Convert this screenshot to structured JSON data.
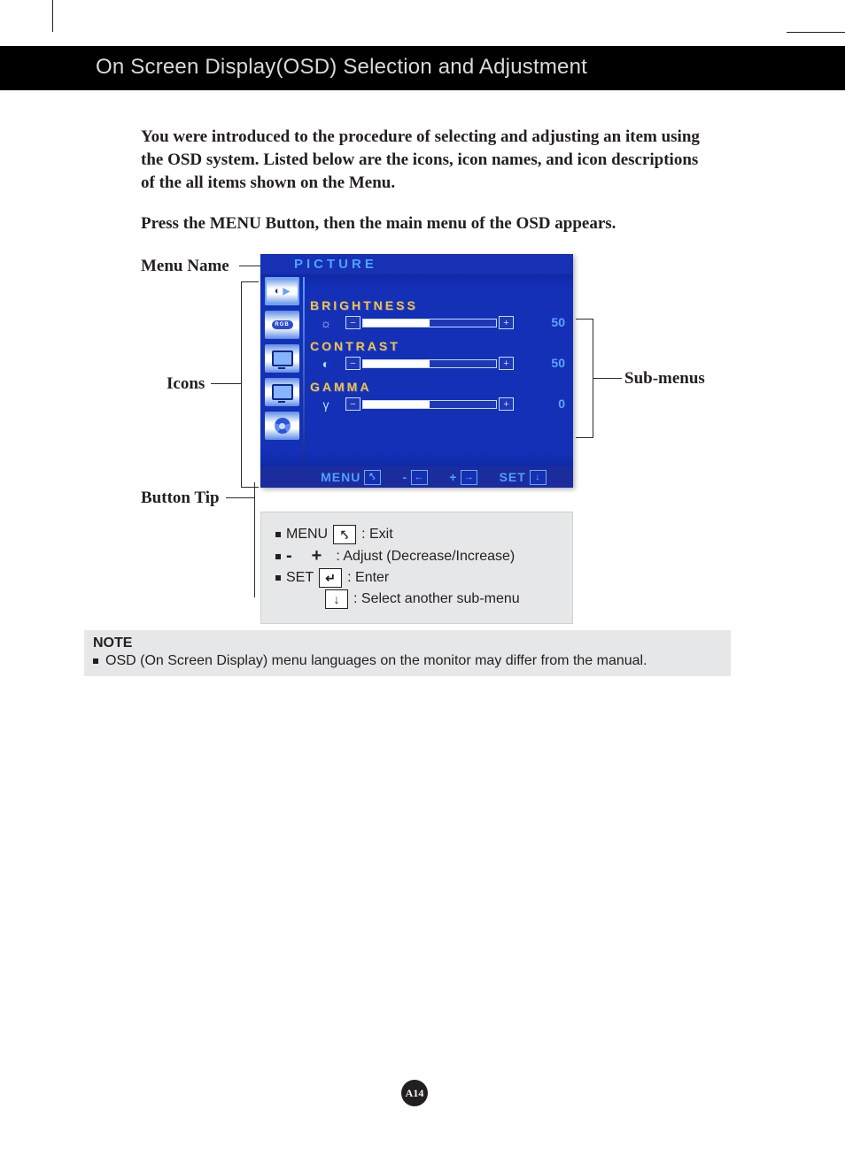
{
  "header": {
    "title": "On Screen Display(OSD) Selection and Adjustment"
  },
  "intro": {
    "p1": "You were introduced to the procedure of selecting and adjusting an item using the OSD system.  Listed below are the icons, icon names, and icon descriptions of the all items shown on the Menu.",
    "p2": "Press the MENU Button, then the main menu of the OSD appears."
  },
  "labels": {
    "menu_name": "Menu Name",
    "icons": "Icons",
    "submenus": "Sub-menus",
    "button_tip": "Button Tip"
  },
  "osd": {
    "title": "PICTURE",
    "icons": [
      {
        "name": "picture-icon",
        "glyph": "◐"
      },
      {
        "name": "rgb-icon",
        "glyph": "RGB"
      },
      {
        "name": "position-icon",
        "glyph": "mon"
      },
      {
        "name": "tracking-icon",
        "glyph": "mon"
      },
      {
        "name": "setup-icon",
        "glyph": "gear"
      }
    ],
    "submenus": [
      {
        "label": "BRIGHTNESS",
        "icon": "☼",
        "value": "50",
        "fill_pct": 50
      },
      {
        "label": "CONTRAST",
        "icon": "◐",
        "value": "50",
        "fill_pct": 50
      },
      {
        "label": "GAMMA",
        "icon": "γ",
        "value": "0",
        "fill_pct": 50
      }
    ],
    "bar": {
      "menu": "MENU",
      "menu_key": "⤣",
      "minus": "-",
      "minus_key": "←",
      "plus": "+",
      "plus_key": "→",
      "set": "SET",
      "set_key": "↓"
    }
  },
  "tips": {
    "menu_label": "MENU",
    "menu_key": "⤣",
    "menu_text": ": Exit",
    "adjust_minus": "-",
    "adjust_plus": "+",
    "adjust_text": ": Adjust (Decrease/Increase)",
    "set_label": "SET",
    "set_key": "↵",
    "set_text": ": Enter",
    "down_key": "↓",
    "down_text": ": Select another sub-menu"
  },
  "note": {
    "title": "NOTE",
    "text": "OSD (On Screen Display) menu languages on the monitor may differ from the manual."
  },
  "footer": {
    "page": "A14"
  }
}
